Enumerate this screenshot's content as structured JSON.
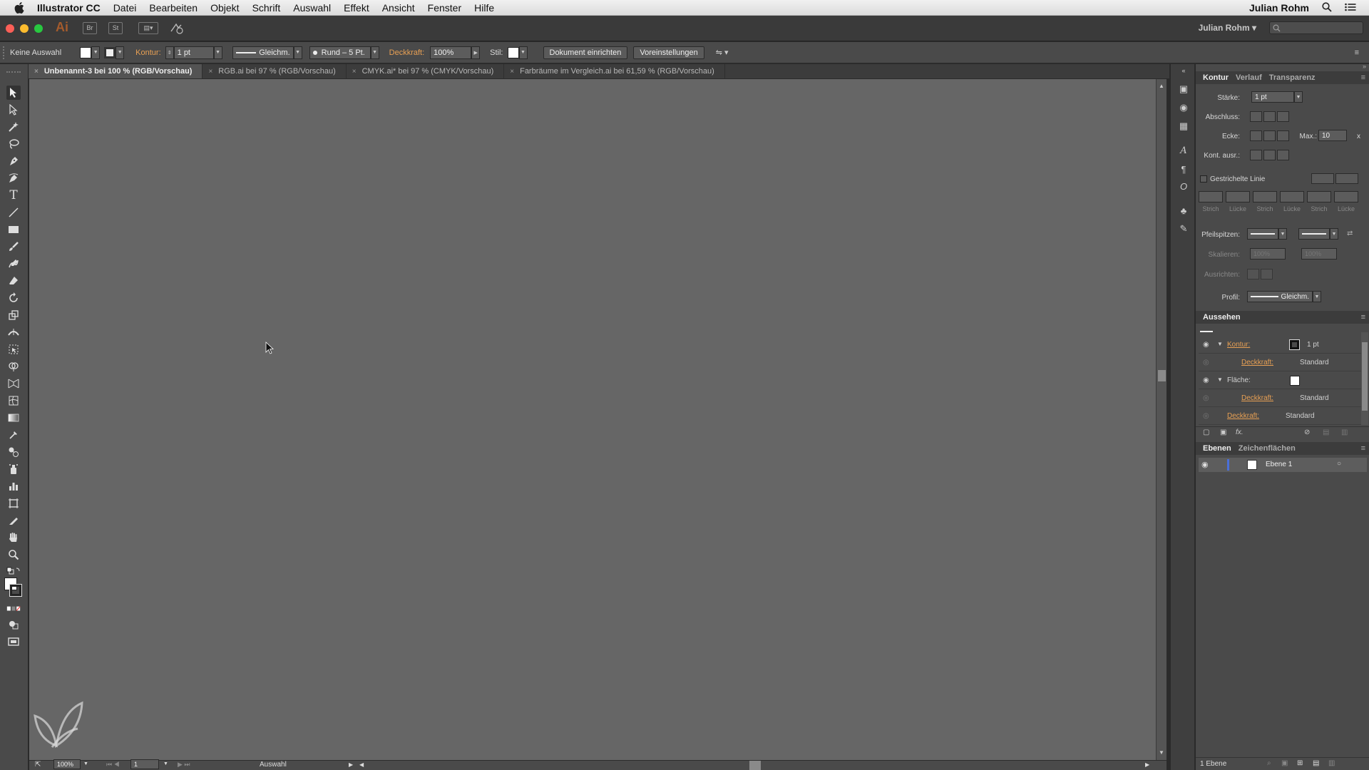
{
  "menubar": {
    "app_name": "Illustrator CC",
    "items": [
      "Datei",
      "Bearbeiten",
      "Objekt",
      "Schrift",
      "Auswahl",
      "Effekt",
      "Ansicht",
      "Fenster",
      "Hilfe"
    ],
    "user": "Julian Rohm"
  },
  "appbar": {
    "logo": "Ai",
    "bridge_label": "Br",
    "stock_label": "St",
    "workspace": "Julian Rohm"
  },
  "controlbar": {
    "selection": "Keine Auswahl",
    "stroke_label": "Kontur:",
    "stroke_weight": "1 pt",
    "profile": "Gleichm.",
    "brush": "Rund – 5 Pt.",
    "opacity_label": "Deckkraft:",
    "opacity": "100%",
    "style_label": "Stil:",
    "doc_setup": "Dokument einrichten",
    "prefs": "Voreinstellungen"
  },
  "tabs": [
    {
      "label": "Unbenannt-3 bei 100 % (RGB/Vorschau)",
      "active": true
    },
    {
      "label": "RGB.ai bei 97 % (RGB/Vorschau)",
      "active": false
    },
    {
      "label": "CMYK.ai* bei 97 % (CMYK/Vorschau)",
      "active": false
    },
    {
      "label": "Farbräume im Vergleich.ai bei 61,59 % (RGB/Vorschau)",
      "active": false
    }
  ],
  "statusbar": {
    "zoom": "100%",
    "artboard": "1",
    "status": "Auswahl"
  },
  "stroke_panel": {
    "tabs": [
      "Kontur",
      "Verlauf",
      "Transparenz"
    ],
    "weight_label": "Stärke:",
    "weight": "1 pt",
    "cap_label": "Abschluss:",
    "corner_label": "Ecke:",
    "limit_label": "Max.:",
    "limit": "10",
    "limit_unit": "x",
    "align_label": "Kont. ausr.:",
    "dashed_label": "Gestrichelte Linie",
    "dash_labels": [
      "Strich",
      "Lücke",
      "Strich",
      "Lücke",
      "Strich",
      "Lücke"
    ],
    "arrow_label": "Pfeilspitzen:",
    "scale_label": "Skalieren:",
    "scale_1": "100%",
    "scale_2": "100%",
    "arrow_align_label": "Ausrichten:",
    "profile_label": "Profil:",
    "profile": "Gleichm."
  },
  "appearance_panel": {
    "title": "Aussehen",
    "rows": [
      {
        "label": "Kontur:",
        "value": "1 pt",
        "kind": "stroke"
      },
      {
        "label": "Deckkraft:",
        "value": "Standard",
        "kind": "sub"
      },
      {
        "label": "Fläche:",
        "value": "",
        "kind": "fill"
      },
      {
        "label": "Deckkraft:",
        "value": "Standard",
        "kind": "sub"
      },
      {
        "label": "Deckkraft:",
        "value": "Standard",
        "kind": "top"
      }
    ],
    "fx_label": "fx."
  },
  "layers_panel": {
    "tabs": [
      "Ebenen",
      "Zeichenflächen"
    ],
    "layer_name": "Ebene 1",
    "count": "1 Ebene"
  },
  "colors": {
    "accent_orange": "#e8a054",
    "layer_blue": "#4a6fd8",
    "canvas": "#666666"
  }
}
